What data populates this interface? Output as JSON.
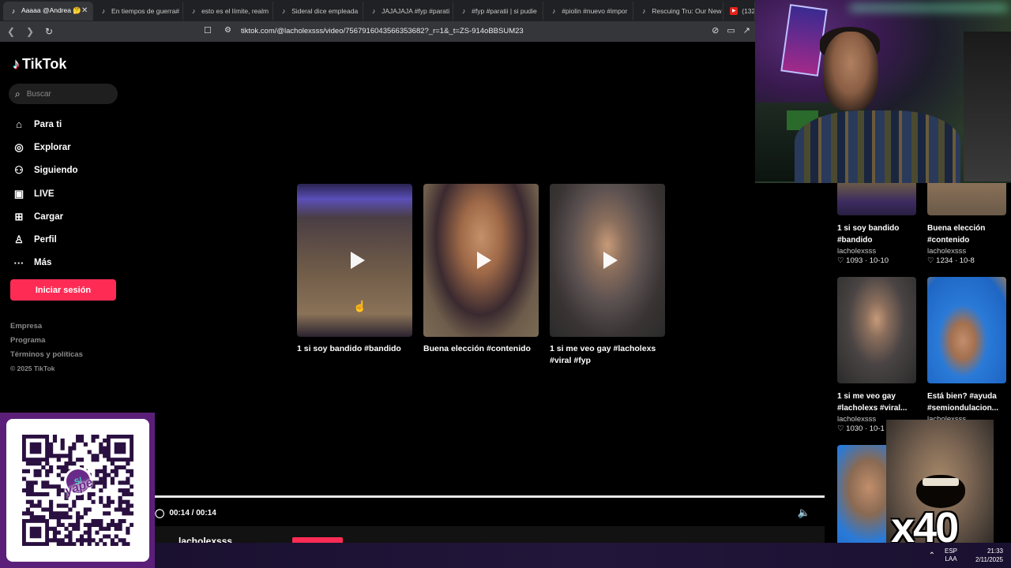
{
  "browser": {
    "tabs": [
      {
        "label": "Aaaaa @Andrea 🤔",
        "active": true
      },
      {
        "label": "En tiempos de guerra#"
      },
      {
        "label": "esto es el límite, realm"
      },
      {
        "label": "Sideral dice empleada"
      },
      {
        "label": "JAJAJAJA #fyp #parati"
      },
      {
        "label": "#fyp #paratii | si pudie"
      },
      {
        "label": "#piolin #nuevo #impor"
      },
      {
        "label": "Rescuing Tru: Our New"
      },
      {
        "label": "(132)"
      }
    ],
    "url": "tiktok.com/@lacholexsss/video/7567916043566353682?_r=1&_t=ZS-914oBBSUM23"
  },
  "sidebar": {
    "logo": "TikTok",
    "search_placeholder": "Buscar",
    "nav": [
      {
        "label": "Para ti",
        "icon": "home-icon"
      },
      {
        "label": "Explorar",
        "icon": "compass-icon"
      },
      {
        "label": "Siguiendo",
        "icon": "following-icon"
      },
      {
        "label": "LIVE",
        "icon": "live-icon"
      },
      {
        "label": "Cargar",
        "icon": "upload-icon"
      },
      {
        "label": "Perfil",
        "icon": "profile-icon"
      },
      {
        "label": "Más",
        "icon": "more-icon"
      }
    ],
    "login_label": "Iniciar sesión",
    "footer": [
      "Empresa",
      "Programa",
      "Términos y políticas"
    ],
    "copyright": "© 2025 TikTok"
  },
  "player": {
    "related": [
      {
        "title": "1 si soy bandido #bandido"
      },
      {
        "title": "Buena elección #contenido"
      },
      {
        "title": "1 si me veo gay #lacholexs #viral #fyp"
      }
    ],
    "time": "00:14 / 00:14",
    "progress": 1.0,
    "author": "lacholexsss"
  },
  "recommendations": [
    {
      "title": "1 si soy bandido #bandido",
      "author": "lacholexsss",
      "likes": "1093",
      "date": "10-10"
    },
    {
      "title": "Buena elección #contenido",
      "author": "lacholexsss",
      "likes": "1234",
      "date": "10-8"
    },
    {
      "title": "1 si me veo gay #lacholexs #viral...",
      "author": "lacholexsss",
      "likes": "1030",
      "date": "10-1"
    },
    {
      "title": "Está bien? #ayuda #semiondulacion...",
      "author": "lacholexsss"
    }
  ],
  "overlays": {
    "meme_text": "x40",
    "qr_brand": "yape",
    "qr_logo": "S/"
  },
  "taskbar": {
    "lang_line1": "ESP",
    "lang_line2": "LAA",
    "time": "21:33",
    "date": "2/11/2025"
  }
}
